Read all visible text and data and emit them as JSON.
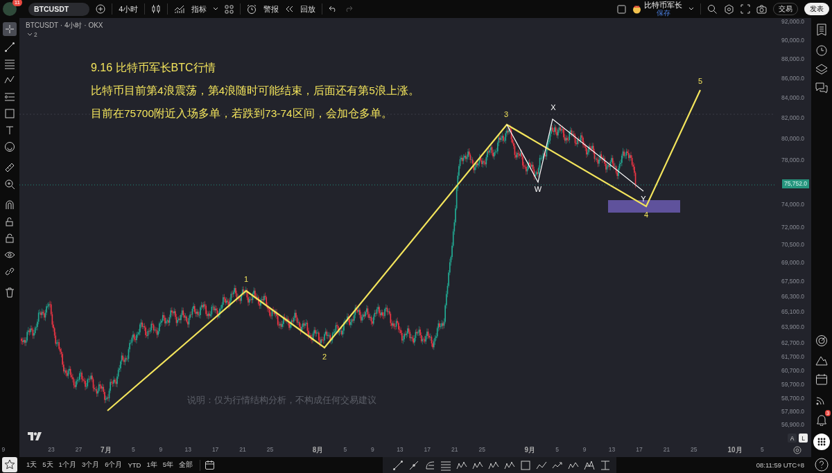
{
  "toolbar": {
    "avatar_badge": "11",
    "symbol": "BTCUSDT",
    "interval": "4小时",
    "indicators": "指标",
    "alert": "警报",
    "replay": "回放"
  },
  "account": {
    "name": "比特币军长",
    "status": "保存"
  },
  "buttons": {
    "trade": "交易",
    "publish": "发表"
  },
  "legend": {
    "title": "BTCUSDT · 4小时 · OKX",
    "collapse_count": "2"
  },
  "annotation": {
    "title": "9.16 比特币军长BTC行情",
    "lines": [
      "比特币目前第4浪震荡，第4浪随时可能结束，后面还有第5浪上涨。",
      "目前在75700附近入场多单，若跌到73-74区间，会加仓多单。"
    ],
    "disclaimer": "说明：仅为行情结构分析，不构成任何交易建议"
  },
  "waves": [
    {
      "label": "1",
      "kind": "impulse"
    },
    {
      "label": "2",
      "kind": "impulse"
    },
    {
      "label": "3",
      "kind": "impulse"
    },
    {
      "label": "4",
      "kind": "impulse"
    },
    {
      "label": "5",
      "kind": "impulse"
    },
    {
      "label": "W",
      "kind": "corrective"
    },
    {
      "label": "X",
      "kind": "corrective"
    },
    {
      "label": "Y",
      "kind": "corrective"
    }
  ],
  "price_axis": {
    "labels": [
      "92,000.0",
      "90,000.0",
      "88,000.0",
      "86,000.0",
      "84,000.0",
      "82,000.0",
      "80,000.0",
      "78,000.0",
      "74,000.0",
      "72,000.0",
      "70,500.0",
      "69,000.0",
      "67,500.0",
      "66,300.0",
      "65,100.0",
      "63,900.0",
      "62,700.0",
      "61,700.0",
      "60,700.0",
      "59,700.0",
      "58,700.0",
      "57,800.0",
      "56,900.0"
    ],
    "last_price": "75,752.0"
  },
  "time_axis": {
    "labels": [
      {
        "text": "9",
        "kind": "day"
      },
      {
        "text": "23",
        "kind": "day"
      },
      {
        "text": "27",
        "kind": "day"
      },
      {
        "text": "7月",
        "kind": "month"
      },
      {
        "text": "5",
        "kind": "day"
      },
      {
        "text": "9",
        "kind": "day"
      },
      {
        "text": "13",
        "kind": "day"
      },
      {
        "text": "17",
        "kind": "day"
      },
      {
        "text": "21",
        "kind": "day"
      },
      {
        "text": "25",
        "kind": "day"
      },
      {
        "text": "8月",
        "kind": "month"
      },
      {
        "text": "5",
        "kind": "day"
      },
      {
        "text": "9",
        "kind": "day"
      },
      {
        "text": "13",
        "kind": "day"
      },
      {
        "text": "17",
        "kind": "day"
      },
      {
        "text": "21",
        "kind": "day"
      },
      {
        "text": "25",
        "kind": "day"
      },
      {
        "text": "9月",
        "kind": "month"
      },
      {
        "text": "5",
        "kind": "day"
      },
      {
        "text": "9",
        "kind": "day"
      },
      {
        "text": "13",
        "kind": "day"
      },
      {
        "text": "17",
        "kind": "day"
      },
      {
        "text": "21",
        "kind": "day"
      },
      {
        "text": "25",
        "kind": "day"
      },
      {
        "text": "10月",
        "kind": "month"
      },
      {
        "text": "5",
        "kind": "day"
      }
    ]
  },
  "scale_buttons": [
    {
      "label": "A",
      "selected": false
    },
    {
      "label": "L",
      "selected": true
    }
  ],
  "ranges": [
    "1天",
    "5天",
    "1个月",
    "3个月",
    "6个月",
    "YTD",
    "1年",
    "5年",
    "全部"
  ],
  "clock": "08:11:59 UTC+8",
  "alerts_badge": "3"
}
